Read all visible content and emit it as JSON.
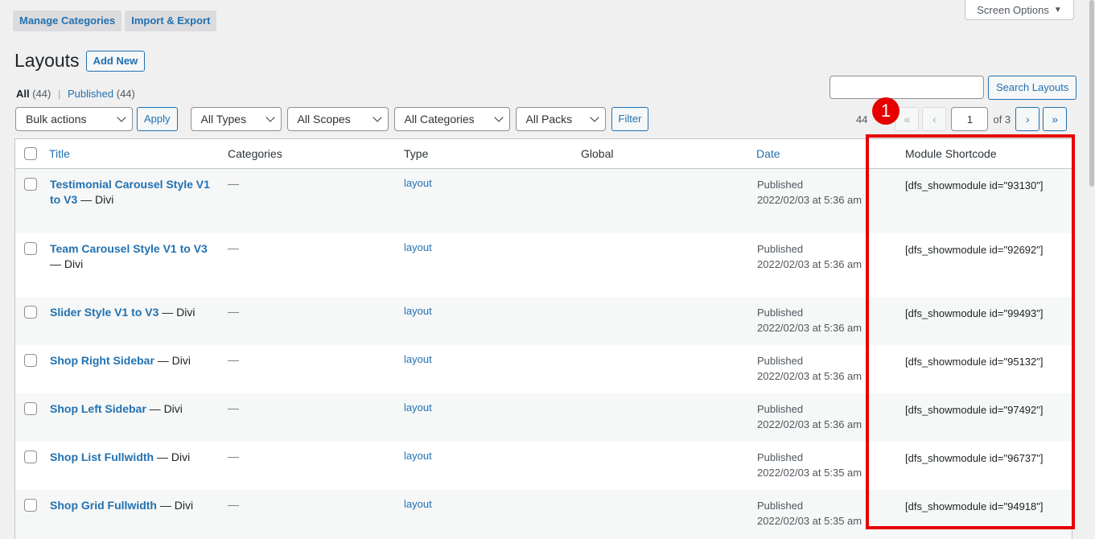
{
  "nav": {
    "tabs": [
      "Manage Categories",
      "Import & Export"
    ]
  },
  "screen_options": {
    "label": "Screen Options",
    "icon": "triangle-down-icon"
  },
  "page": {
    "title": "Layouts",
    "add_new": "Add New"
  },
  "views": {
    "all_label": "All",
    "all_count": "(44)",
    "sep": "|",
    "published_label": "Published",
    "published_count": "(44)"
  },
  "search": {
    "value": "",
    "button": "Search Layouts"
  },
  "filters": {
    "bulk": "Bulk actions",
    "apply": "Apply",
    "types": "All Types",
    "scopes": "All Scopes",
    "categories": "All Categories",
    "packs": "All Packs",
    "filter": "Filter"
  },
  "pagination": {
    "count": "44",
    "first": "«",
    "prev": "‹",
    "current": "1",
    "of": "of 3",
    "next": "›",
    "last": "»"
  },
  "annotation": {
    "number": "1"
  },
  "table": {
    "headers": {
      "title": "Title",
      "categories": "Categories",
      "type": "Type",
      "global": "Global",
      "date": "Date",
      "shortcode": "Module Shortcode"
    },
    "rows": [
      {
        "title": "Testimonial Carousel Style V1 to V3",
        "suffix": " — Divi",
        "categories": "—",
        "type": "layout",
        "status": "Published",
        "date": "2022/02/03 at 5:36 am",
        "shortcode": "[dfs_showmodule id=\"93130\"]"
      },
      {
        "title": "Team Carousel Style V1 to V3",
        "suffix": " — Divi",
        "categories": "—",
        "type": "layout",
        "status": "Published",
        "date": "2022/02/03 at 5:36 am",
        "shortcode": "[dfs_showmodule id=\"92692\"]"
      },
      {
        "title": "Slider Style V1 to V3",
        "suffix": " — Divi",
        "categories": "—",
        "type": "layout",
        "status": "Published",
        "date": "2022/02/03 at 5:36 am",
        "shortcode": "[dfs_showmodule id=\"99493\"]"
      },
      {
        "title": "Shop Right Sidebar",
        "suffix": " — Divi",
        "categories": "—",
        "type": "layout",
        "status": "Published",
        "date": "2022/02/03 at 5:36 am",
        "shortcode": "[dfs_showmodule id=\"95132\"]"
      },
      {
        "title": "Shop Left Sidebar",
        "suffix": " — Divi",
        "categories": "—",
        "type": "layout",
        "status": "Published",
        "date": "2022/02/03 at 5:36 am",
        "shortcode": "[dfs_showmodule id=\"97492\"]"
      },
      {
        "title": "Shop List Fullwidth",
        "suffix": " — Divi",
        "categories": "—",
        "type": "layout",
        "status": "Published",
        "date": "2022/02/03 at 5:35 am",
        "shortcode": "[dfs_showmodule id=\"96737\"]"
      },
      {
        "title": "Shop Grid Fullwidth",
        "suffix": " — Divi",
        "categories": "—",
        "type": "layout",
        "status": "Published",
        "date": "2022/02/03 at 5:35 am",
        "shortcode": "[dfs_showmodule id=\"94918\"]"
      }
    ]
  },
  "colors": {
    "link": "#2271b1",
    "highlight": "#e60000",
    "background": "#f0f0f1"
  }
}
